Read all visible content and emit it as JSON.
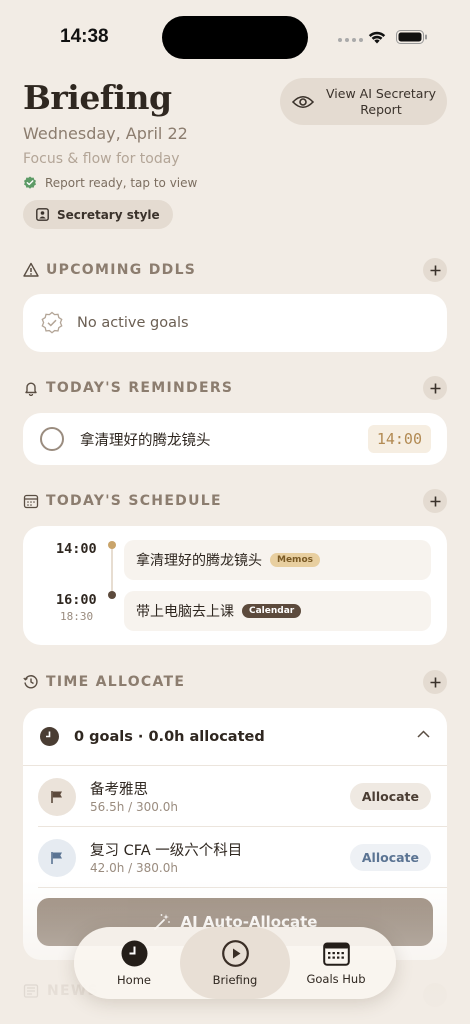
{
  "status": {
    "time": "14:38"
  },
  "header": {
    "title": "Briefing",
    "date": "Wednesday, April 22",
    "subtitle": "Focus & flow for today",
    "report_status": "Report ready, tap to view",
    "style_chip": "Secretary style",
    "view_report_button": "View AI Secretary Report"
  },
  "sections": {
    "ddls": {
      "label": "UPCOMING DDLS",
      "empty_text": "No active goals"
    },
    "reminders": {
      "label": "TODAY'S REMINDERS",
      "items": [
        {
          "text": "拿清理好的腾龙镜头",
          "time": "14:00"
        }
      ]
    },
    "schedule": {
      "label": "TODAY'S SCHEDULE",
      "items": [
        {
          "start": "14:00",
          "end": "",
          "title": "拿清理好的腾龙镜头",
          "tag": "Memos",
          "dot_color": "#c9a46a"
        },
        {
          "start": "16:00",
          "end": "18:30",
          "title": "带上电脑去上课",
          "tag": "Calendar",
          "dot_color": "#5c4a3c"
        }
      ]
    },
    "time_allocate": {
      "label": "TIME ALLOCATE",
      "summary": "0 goals · 0.0h allocated",
      "goals": [
        {
          "name": "备考雅思",
          "hours": "56.5h / 300.0h",
          "button": "Allocate",
          "accent": "#5c4a3c"
        },
        {
          "name": "复习 CFA 一级六个科目",
          "hours": "42.0h / 380.0h",
          "button": "Allocate",
          "accent": "#5b7493"
        }
      ],
      "auto_button": "AI Auto-Allocate"
    },
    "news": {
      "label": "NEWS"
    }
  },
  "tab_bar": {
    "tabs": [
      {
        "label": "Home",
        "icon": "clock-icon"
      },
      {
        "label": "Briefing",
        "icon": "play-icon",
        "active": true
      },
      {
        "label": "Goals Hub",
        "icon": "calendar-grid-icon"
      }
    ]
  }
}
